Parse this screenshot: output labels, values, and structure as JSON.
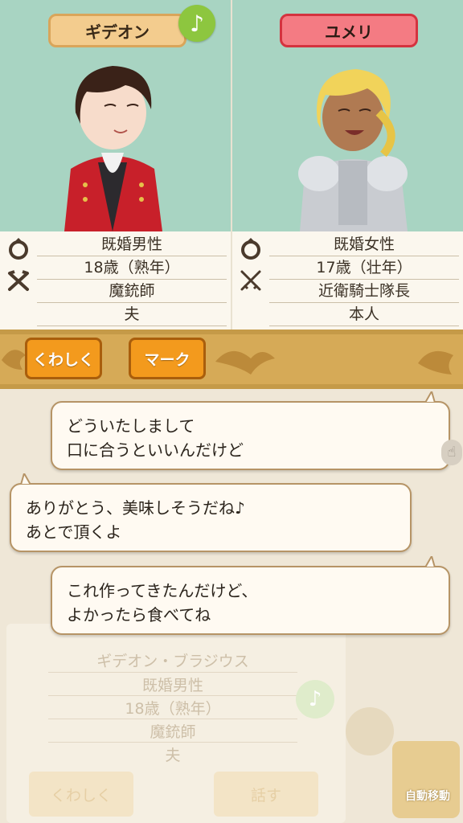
{
  "left_character": {
    "name": "ギデオン",
    "marital": "既婚男性",
    "age": "18歳（熟年）",
    "job": "魔銃師",
    "relation": "夫"
  },
  "right_character": {
    "name": "ユメリ",
    "marital": "既婚女性",
    "age": "17歳（壮年）",
    "job": "近衛騎士隊長",
    "relation": "本人"
  },
  "music_icon": "♪",
  "buttons": {
    "detail": "くわしく",
    "mark": "マーク"
  },
  "dialogue": [
    {
      "line1": "どういたしまして",
      "line2": "口に合うといいんだけど"
    },
    {
      "line1": "ありがとう、美味しそうだね♪",
      "line2": "あとで頂くよ"
    },
    {
      "line1": "これ作ってきたんだけど、",
      "line2": "よかったら食べてね"
    }
  ],
  "background_card": {
    "full_name": "ギデオン・ブラジウス",
    "marital": "既婚男性",
    "age": "18歳（熟年）",
    "job": "魔銃師",
    "relation": "夫",
    "detail_button": "くわしく",
    "talk_button": "話す",
    "auto_move": "自動移動"
  },
  "colors": {
    "panel_bg": "#a8d4c2",
    "left_tag": "#f3cc8e",
    "right_tag": "#f47b83",
    "button": "#f39a1d",
    "music": "#8dc63f"
  }
}
